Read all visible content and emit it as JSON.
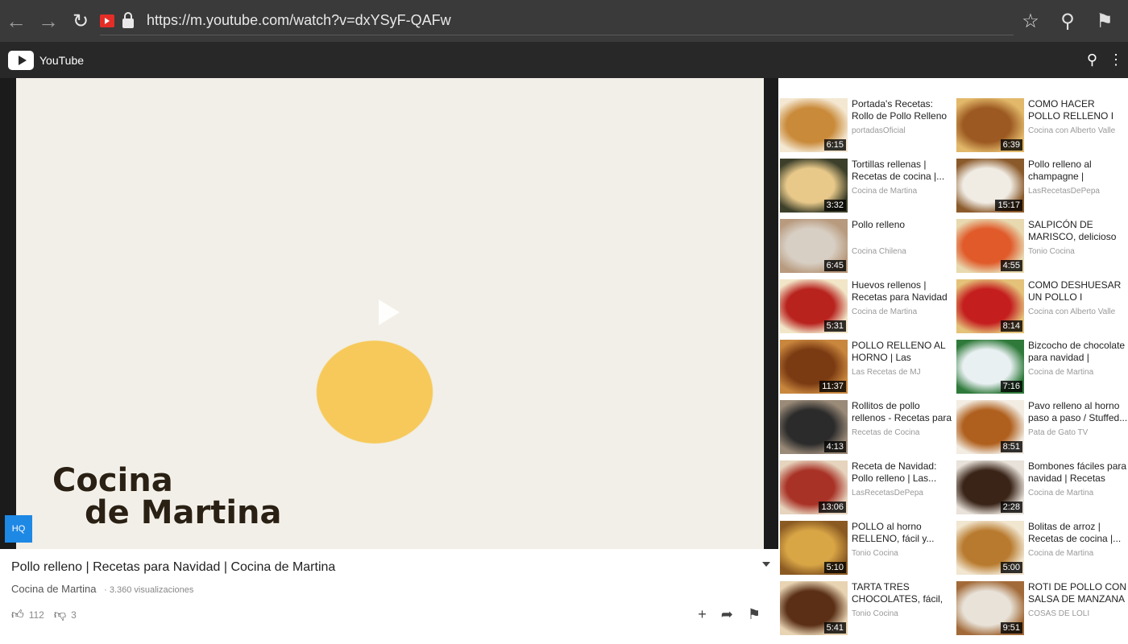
{
  "browser": {
    "url": "https://m.youtube.com/watch?v=dxYSyF-QAFw"
  },
  "header": {
    "app_name": "YouTube"
  },
  "video": {
    "watermark_line1": "Cocina",
    "watermark_line2": "de Martina",
    "hq_label": "HQ",
    "title": "Pollo relleno | Recetas para Navidad | Cocina de Martina",
    "channel": "Cocina de Martina",
    "views": "· 3.360 visualizaciones",
    "likes": "112",
    "dislikes": "3"
  },
  "related": [
    {
      "title": "Portada's Recetas: Rollo de Pollo Relleno",
      "channel": "portadasOficial",
      "duration": "6:15",
      "color1": "#c98a3a",
      "color2": "#f4e8d2"
    },
    {
      "title": "COMO HACER POLLO RELLENO I RECETAS D...",
      "channel": "Cocina con Alberto Valle",
      "duration": "6:39",
      "color1": "#9c5a22",
      "color2": "#e2b86a"
    },
    {
      "title": "Tortillas rellenas | Recetas de cocina |...",
      "channel": "Cocina de Martina",
      "duration": "3:32",
      "color1": "#e8c98a",
      "color2": "#3c3f2a"
    },
    {
      "title": "Pollo relleno al champagne | RECETA...",
      "channel": "LasRecetasDePepa",
      "duration": "15:17",
      "color1": "#f0ece4",
      "color2": "#8b5a2b"
    },
    {
      "title": "Pollo relleno",
      "channel": "Cocina Chilena",
      "duration": "6:45",
      "color1": "#d8cfc4",
      "color2": "#b89a7e"
    },
    {
      "title": "SALPICÓN DE MARISCO, delicioso y...",
      "channel": "Tonio Cocina",
      "duration": "4:55",
      "color1": "#e05a2a",
      "color2": "#e8d9b0"
    },
    {
      "title": "Huevos rellenos | Recetas para Navidad |...",
      "channel": "Cocina de Martina",
      "duration": "5:31",
      "color1": "#b8231e",
      "color2": "#f2e6c8"
    },
    {
      "title": "COMO DESHUESAR UN POLLO I RECETAS DE...",
      "channel": "Cocina con Alberto Valle",
      "duration": "8:14",
      "color1": "#c41e1e",
      "color2": "#e4c27a"
    },
    {
      "title": "POLLO RELLENO AL HORNO | Las Recetas...",
      "channel": "Las Recetas de MJ",
      "duration": "11:37",
      "color1": "#7a3a12",
      "color2": "#c9873e"
    },
    {
      "title": "Bizcocho de chocolate para navidad | Recetas...",
      "channel": "Cocina de Martina",
      "duration": "7:16",
      "color1": "#e9f0f2",
      "color2": "#2f7a3a"
    },
    {
      "title": "Rollitos de pollo rellenos - Recetas para navidad",
      "channel": "Recetas de Cocina",
      "duration": "4:13",
      "color1": "#2b2b2b",
      "color2": "#9a8a78"
    },
    {
      "title": "Pavo relleno al horno paso a paso / Stuffed...",
      "channel": "Pata de Gato TV",
      "duration": "8:51",
      "color1": "#b0601e",
      "color2": "#f2ece2"
    },
    {
      "title": "Receta de Navidad: Pollo relleno | Las...",
      "channel": "LasRecetasDePepa",
      "duration": "13:06",
      "color1": "#a83226",
      "color2": "#e6d4be"
    },
    {
      "title": "Bombones fáciles para navidad | Recetas para...",
      "channel": "Cocina de Martina",
      "duration": "2:28",
      "color1": "#3a2418",
      "color2": "#e8e2da"
    },
    {
      "title": "POLLO al horno RELLENO, fácil y...",
      "channel": "Tonio Cocina",
      "duration": "5:10",
      "color1": "#d9a646",
      "color2": "#8a5a22"
    },
    {
      "title": "Bolitas de arroz | Recetas de cocina |...",
      "channel": "Cocina de Martina",
      "duration": "5:00",
      "color1": "#b87a2e",
      "color2": "#f1e6d0"
    },
    {
      "title": "TARTA TRES CHOCOLATES, fácil, si...",
      "channel": "Tonio Cocina",
      "duration": "5:41",
      "color1": "#5a2f16",
      "color2": "#e8d4b2"
    },
    {
      "title": "ROTI DE POLLO CON SALSA DE MANZANA ...",
      "channel": "COSAS DE LOLI",
      "duration": "9:51",
      "color1": "#e8e2d8",
      "color2": "#a26a38"
    }
  ]
}
